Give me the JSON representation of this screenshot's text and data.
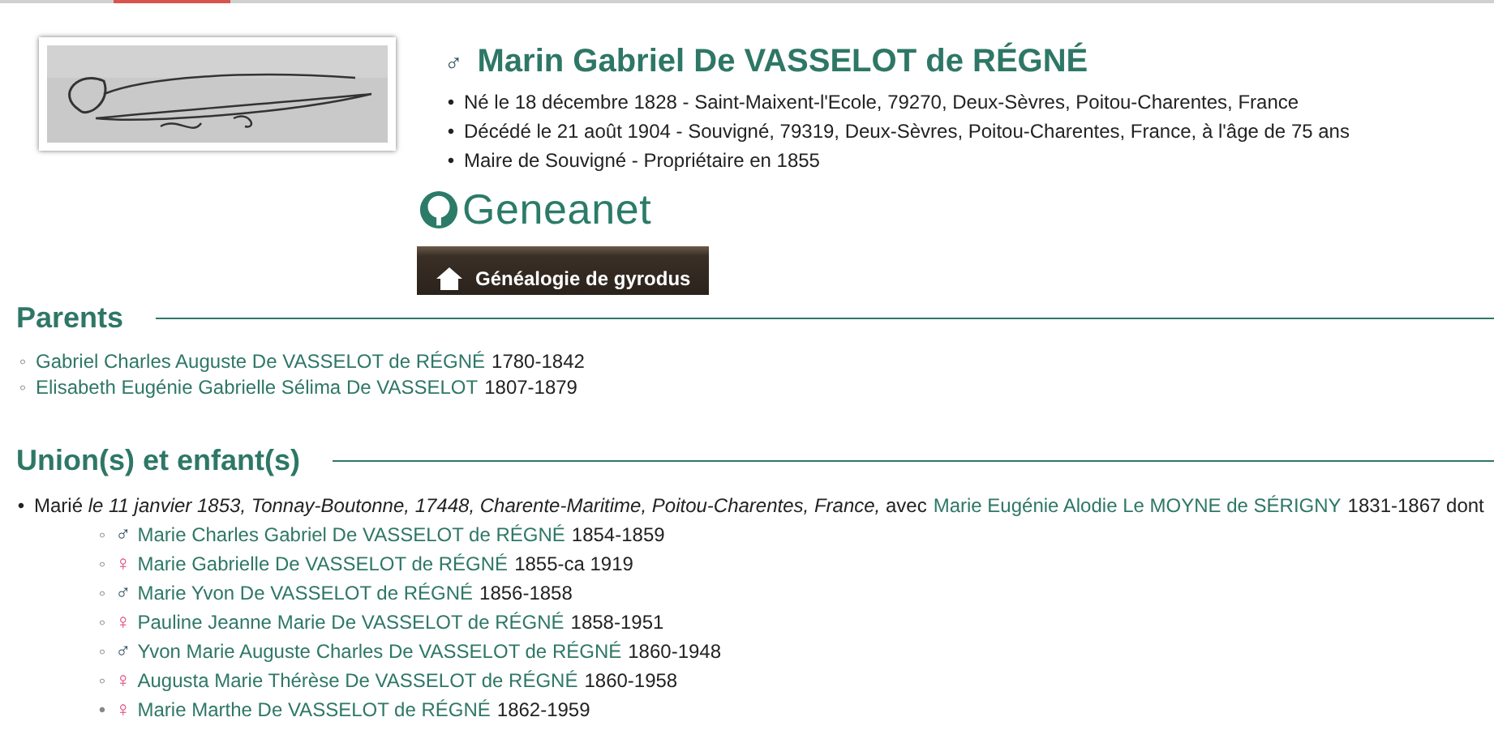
{
  "person": {
    "kind": "male",
    "symbol": "♂",
    "name": "Marin Gabriel De VASSELOT de RÉGNÉ",
    "facts": [
      {
        "bullet": "•",
        "text": "Né le 18 décembre 1828 - Saint-Maixent-l'Ecole, 79270, Deux-Sèvres, Poitou-Charentes, France"
      },
      {
        "bullet": "•",
        "text": "Décédé le 21 août 1904 - Souvigné, 79319, Deux-Sèvres, Poitou-Charentes, France, à l'âge de 75 ans"
      },
      {
        "bullet": "•",
        "text": "Maire de Souvigné - Propriétaire en 1855"
      }
    ]
  },
  "logo": "Geneanet",
  "banner": "Généalogie de gyrodus",
  "parents": {
    "title": "Parents",
    "items": [
      {
        "bullet": "◦",
        "name": "Gabriel Charles Auguste De VASSELOT de RÉGNÉ",
        "dates": "1780-1842"
      },
      {
        "bullet": "◦",
        "name": "Elisabeth Eugénie Gabrielle Sélima De VASSELOT",
        "dates": "1807-1879"
      }
    ]
  },
  "unions": {
    "title": "Union(s) et enfant(s)",
    "marriage": {
      "bullet": "•",
      "prefix": "Marié",
      "details": "le 11 janvier 1853, Tonnay-Boutonne, 17448, Charente-Maritime, Poitou-Charentes, France,",
      "avec": "avec",
      "spouse": "Marie Eugénie Alodie Le MOYNE de SÉRIGNY",
      "dates": "1831-1867",
      "suffix": "dont"
    },
    "children": [
      {
        "bullet": "◦",
        "kind": "male",
        "symbol": "♂",
        "name": "Marie Charles Gabriel De VASSELOT de RÉGNÉ",
        "dates": "1854-1859"
      },
      {
        "bullet": "◦",
        "kind": "female",
        "symbol": "♀",
        "name": "Marie Gabrielle De VASSELOT de RÉGNÉ",
        "dates": "1855-ca 1919"
      },
      {
        "bullet": "◦",
        "kind": "male",
        "symbol": "♂",
        "name": "Marie Yvon De VASSELOT de RÉGNÉ",
        "dates": "1856-1858"
      },
      {
        "bullet": "◦",
        "kind": "female",
        "symbol": "♀",
        "name": "Pauline Jeanne Marie De VASSELOT de RÉGNÉ",
        "dates": "1858-1951"
      },
      {
        "bullet": "◦",
        "kind": "male",
        "symbol": "♂",
        "name": "Yvon Marie Auguste Charles De VASSELOT de RÉGNÉ",
        "dates": "1860-1948"
      },
      {
        "bullet": "◦",
        "kind": "female",
        "symbol": "♀",
        "name": "Augusta Marie Thérèse De VASSELOT de RÉGNÉ",
        "dates": "1860-1958"
      },
      {
        "bullet": "•",
        "kind": "female",
        "symbol": "♀",
        "name": "Marie Marthe De VASSELOT de RÉGNÉ",
        "dates": "1862-1959"
      }
    ]
  }
}
